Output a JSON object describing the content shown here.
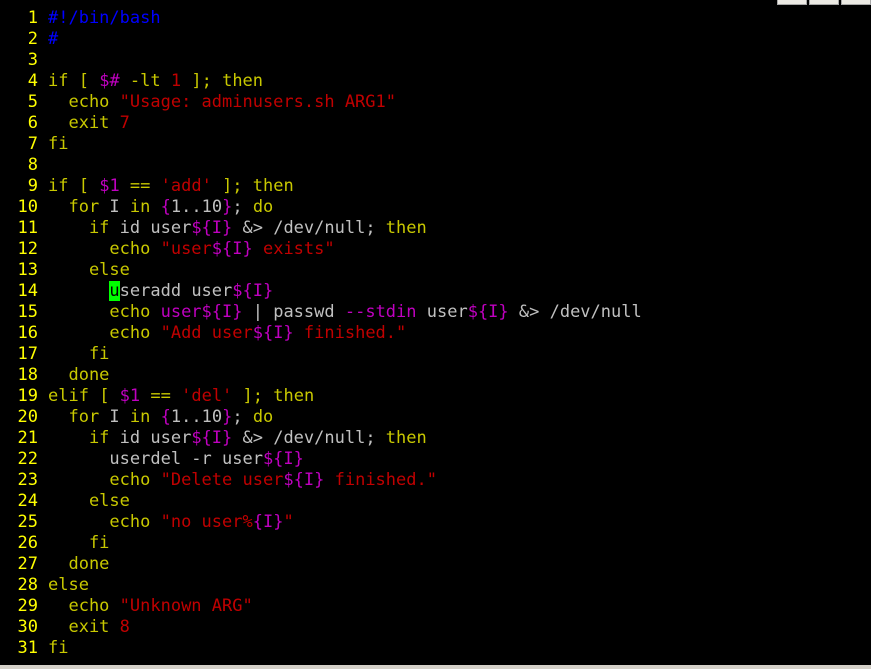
{
  "editor": {
    "colors": {
      "background": "#000000",
      "line_number": "#ffff00",
      "text": "#c0c0c0",
      "keyword": "#c8c800",
      "variable": "#c000c0",
      "string": "#c00000",
      "comment": "#0000ff",
      "cursor": "#00ff00"
    },
    "lines": [
      {
        "number": "1",
        "tokens": [
          {
            "t": "#!/bin/bash",
            "c": "cmt"
          }
        ]
      },
      {
        "number": "2",
        "tokens": [
          {
            "t": "#",
            "c": "cmt"
          }
        ]
      },
      {
        "number": "3",
        "tokens": []
      },
      {
        "number": "4",
        "tokens": [
          {
            "t": "if",
            "c": "kw"
          },
          {
            "t": " [ ",
            "c": "kw"
          },
          {
            "t": "$#",
            "c": "var"
          },
          {
            "t": " -lt ",
            "c": "kw"
          },
          {
            "t": "1",
            "c": "num"
          },
          {
            "t": " ]; ",
            "c": "kw"
          },
          {
            "t": "then",
            "c": "kw"
          }
        ]
      },
      {
        "number": "5",
        "tokens": [
          {
            "t": "  echo ",
            "c": "kw"
          },
          {
            "t": "\"Usage: adminusers.sh ARG1\"",
            "c": "str"
          }
        ]
      },
      {
        "number": "6",
        "tokens": [
          {
            "t": "  exit ",
            "c": "kw"
          },
          {
            "t": "7",
            "c": "num"
          }
        ]
      },
      {
        "number": "7",
        "tokens": [
          {
            "t": "fi",
            "c": "kw"
          }
        ]
      },
      {
        "number": "8",
        "tokens": []
      },
      {
        "number": "9",
        "tokens": [
          {
            "t": "if",
            "c": "kw"
          },
          {
            "t": " [ ",
            "c": "kw"
          },
          {
            "t": "$1",
            "c": "var"
          },
          {
            "t": " == ",
            "c": "kw"
          },
          {
            "t": "'add'",
            "c": "str"
          },
          {
            "t": " ]; ",
            "c": "kw"
          },
          {
            "t": "then",
            "c": "kw"
          }
        ]
      },
      {
        "number": "10",
        "tokens": [
          {
            "t": "  for",
            "c": "kw"
          },
          {
            "t": " I ",
            "c": "text"
          },
          {
            "t": "in",
            "c": "kw"
          },
          {
            "t": " ",
            "c": "text"
          },
          {
            "t": "{",
            "c": "var"
          },
          {
            "t": "1..10",
            "c": "text"
          },
          {
            "t": "}",
            "c": "var"
          },
          {
            "t": "; ",
            "c": "text"
          },
          {
            "t": "do",
            "c": "kw"
          }
        ]
      },
      {
        "number": "11",
        "tokens": [
          {
            "t": "    if",
            "c": "kw"
          },
          {
            "t": " id user",
            "c": "text"
          },
          {
            "t": "${I}",
            "c": "var"
          },
          {
            "t": " &> /dev/null; ",
            "c": "text"
          },
          {
            "t": "then",
            "c": "kw"
          }
        ]
      },
      {
        "number": "12",
        "tokens": [
          {
            "t": "      echo ",
            "c": "kw"
          },
          {
            "t": "\"user",
            "c": "str"
          },
          {
            "t": "${I}",
            "c": "var"
          },
          {
            "t": " exists\"",
            "c": "str"
          }
        ]
      },
      {
        "number": "13",
        "tokens": [
          {
            "t": "    else",
            "c": "kw"
          }
        ]
      },
      {
        "number": "14",
        "tokens": [
          {
            "t": "      ",
            "c": "text"
          },
          {
            "t": "u",
            "c": "cursor"
          },
          {
            "t": "seradd user",
            "c": "text"
          },
          {
            "t": "${I}",
            "c": "var"
          }
        ]
      },
      {
        "number": "15",
        "tokens": [
          {
            "t": "      echo ",
            "c": "kw"
          },
          {
            "t": "user",
            "c": "var"
          },
          {
            "t": "${I}",
            "c": "var"
          },
          {
            "t": " | passwd ",
            "c": "text"
          },
          {
            "t": "--stdin",
            "c": "var"
          },
          {
            "t": " user",
            "c": "text"
          },
          {
            "t": "${I}",
            "c": "var"
          },
          {
            "t": " &> /dev/null",
            "c": "text"
          }
        ]
      },
      {
        "number": "16",
        "tokens": [
          {
            "t": "      echo ",
            "c": "kw"
          },
          {
            "t": "\"Add user",
            "c": "str"
          },
          {
            "t": "${I}",
            "c": "var"
          },
          {
            "t": " finished.\"",
            "c": "str"
          }
        ]
      },
      {
        "number": "17",
        "tokens": [
          {
            "t": "    fi",
            "c": "kw"
          }
        ]
      },
      {
        "number": "18",
        "tokens": [
          {
            "t": "  done",
            "c": "kw"
          }
        ]
      },
      {
        "number": "19",
        "tokens": [
          {
            "t": "elif",
            "c": "kw"
          },
          {
            "t": " [ ",
            "c": "kw"
          },
          {
            "t": "$1",
            "c": "var"
          },
          {
            "t": " == ",
            "c": "kw"
          },
          {
            "t": "'del'",
            "c": "str"
          },
          {
            "t": " ]; ",
            "c": "kw"
          },
          {
            "t": "then",
            "c": "kw"
          }
        ]
      },
      {
        "number": "20",
        "tokens": [
          {
            "t": "  for",
            "c": "kw"
          },
          {
            "t": " I ",
            "c": "text"
          },
          {
            "t": "in",
            "c": "kw"
          },
          {
            "t": " ",
            "c": "text"
          },
          {
            "t": "{",
            "c": "var"
          },
          {
            "t": "1..10",
            "c": "text"
          },
          {
            "t": "}",
            "c": "var"
          },
          {
            "t": "; ",
            "c": "text"
          },
          {
            "t": "do",
            "c": "kw"
          }
        ]
      },
      {
        "number": "21",
        "tokens": [
          {
            "t": "    if",
            "c": "kw"
          },
          {
            "t": " id user",
            "c": "text"
          },
          {
            "t": "${I}",
            "c": "var"
          },
          {
            "t": " &> /dev/null; ",
            "c": "text"
          },
          {
            "t": "then",
            "c": "kw"
          }
        ]
      },
      {
        "number": "22",
        "tokens": [
          {
            "t": "      userdel -r user",
            "c": "text"
          },
          {
            "t": "${I}",
            "c": "var"
          }
        ]
      },
      {
        "number": "23",
        "tokens": [
          {
            "t": "      echo ",
            "c": "kw"
          },
          {
            "t": "\"Delete user",
            "c": "str"
          },
          {
            "t": "${I}",
            "c": "var"
          },
          {
            "t": " finished.\"",
            "c": "str"
          }
        ]
      },
      {
        "number": "24",
        "tokens": [
          {
            "t": "    else",
            "c": "kw"
          }
        ]
      },
      {
        "number": "25",
        "tokens": [
          {
            "t": "      echo ",
            "c": "kw"
          },
          {
            "t": "\"no user%",
            "c": "str"
          },
          {
            "t": "{I}",
            "c": "var"
          },
          {
            "t": "\"",
            "c": "str"
          }
        ]
      },
      {
        "number": "26",
        "tokens": [
          {
            "t": "    fi",
            "c": "kw"
          }
        ]
      },
      {
        "number": "27",
        "tokens": [
          {
            "t": "  done",
            "c": "kw"
          }
        ]
      },
      {
        "number": "28",
        "tokens": [
          {
            "t": "else",
            "c": "kw"
          }
        ]
      },
      {
        "number": "29",
        "tokens": [
          {
            "t": "  echo ",
            "c": "kw"
          },
          {
            "t": "\"Unknown ARG\"",
            "c": "str"
          }
        ]
      },
      {
        "number": "30",
        "tokens": [
          {
            "t": "  exit ",
            "c": "kw"
          },
          {
            "t": "8",
            "c": "num"
          }
        ]
      },
      {
        "number": "31",
        "tokens": [
          {
            "t": "fi",
            "c": "kw"
          }
        ]
      }
    ]
  }
}
